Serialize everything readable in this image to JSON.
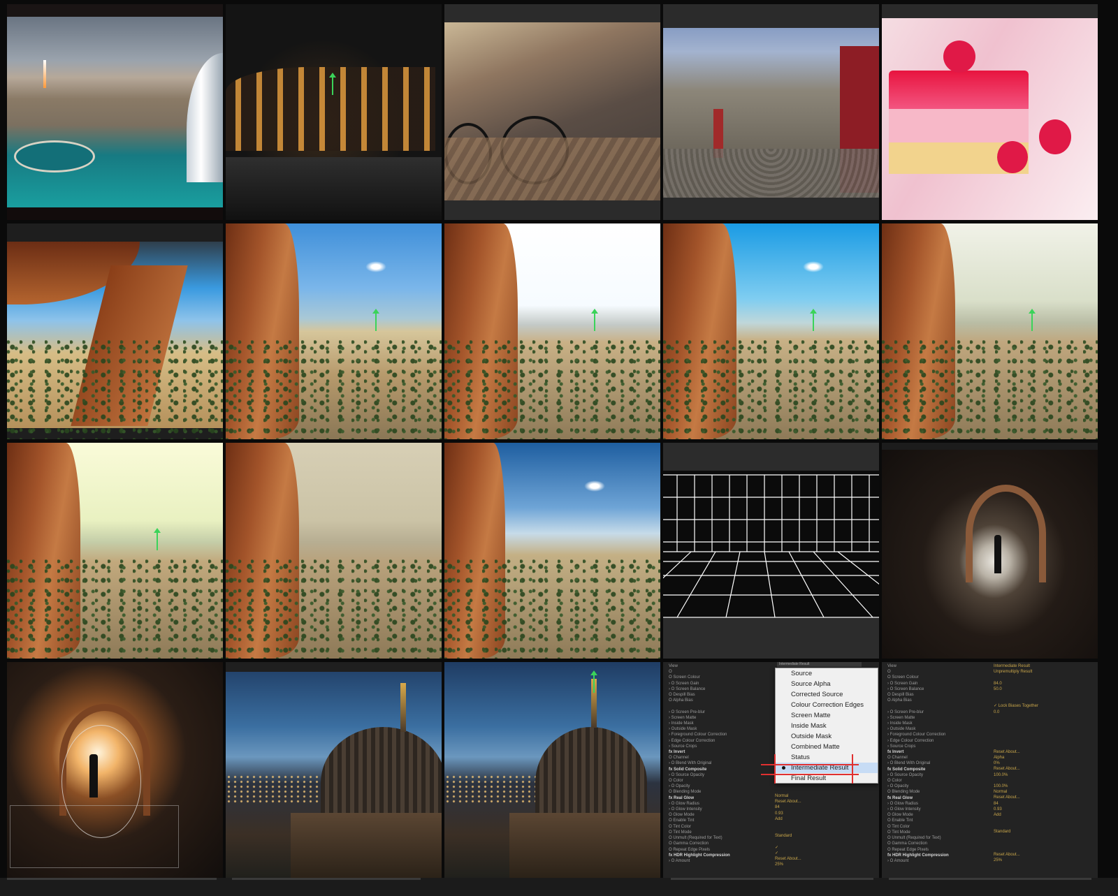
{
  "tiles": [
    {
      "id": "dubai-skyline-photo",
      "kind": "photo"
    },
    {
      "id": "colosseum-night-render",
      "kind": "photo"
    },
    {
      "id": "bicycle-street-photo",
      "kind": "photo"
    },
    {
      "id": "stone-alley-photo",
      "kind": "photo"
    },
    {
      "id": "raspberry-cake-photo",
      "kind": "photo"
    },
    {
      "id": "desert-arch-source",
      "kind": "photo"
    },
    {
      "id": "desert-sky-blue",
      "kind": "photo"
    },
    {
      "id": "desert-sky-white",
      "kind": "photo"
    },
    {
      "id": "desert-sky-cyan",
      "kind": "photo"
    },
    {
      "id": "desert-sky-sage",
      "kind": "photo"
    },
    {
      "id": "desert-sky-lime",
      "kind": "photo"
    },
    {
      "id": "desert-sky-tan",
      "kind": "photo"
    },
    {
      "id": "desert-sky-deep-blue",
      "kind": "photo"
    },
    {
      "id": "perspective-grid-plane",
      "kind": "render"
    },
    {
      "id": "tunnel-silhouette-photo",
      "kind": "photo"
    },
    {
      "id": "tunnel-warm-mask-photo",
      "kind": "photo"
    },
    {
      "id": "berlin-dome-dusk",
      "kind": "photo"
    },
    {
      "id": "berlin-dome-3d-axes",
      "kind": "photo"
    },
    {
      "id": "keylight-view-dropdown",
      "kind": "panel"
    },
    {
      "id": "keylight-effect-controls",
      "kind": "panel"
    }
  ],
  "panel_left": {
    "view_label": "View",
    "view_value": "Intermediate Result",
    "rows": [
      "View",
      "Ö",
      "Ö Screen Colour",
      "› Ö Screen Gain",
      "› Ö Screen Balance",
      "  Ö Despill Bias",
      "  Ö Alpha Bias",
      "",
      "› Ö Screen Pre-blur",
      "› Screen Matte",
      "› Inside Mask",
      "› Outside Mask",
      "› Foreground Colour Correction",
      "› Edge Colour Correction",
      "› Source Crops",
      "fx Invert",
      "  Ö Channel",
      "› Ö Blend With Original",
      "fx Solid Composite",
      "› Ö Source Opacity",
      "  Ö Color",
      "› Ö Opacity",
      "  Ö Blending Mode",
      "fx Real Glow",
      "› Ö Glow Radius",
      "› Ö Glow Intensity",
      "  Ö Glow Mode",
      "  Ö Enable Tint",
      "  Ö Tint Color",
      "  Ö Tint Mode",
      "  Ö Unmult (Required for Text)",
      "  Ö Gamma Correction",
      "  Ö Repeat Edge Pixels",
      "fx HDR Highlight Compression",
      "› Ö Amount"
    ],
    "dropdown_options": [
      "Source",
      "Source Alpha",
      "Corrected Source",
      "Colour Correction Edges",
      "Screen Matte",
      "Inside Mask",
      "Outside Mask",
      "Combined Matte",
      "Status",
      "Intermediate Result",
      "Final Result"
    ],
    "selected_option": "Intermediate Result",
    "values": [
      "Normal",
      "Reset      About...",
      "84",
      "0.93",
      "Add",
      "",
      "",
      "Standard",
      "",
      "✓",
      "✓",
      "Reset      About...",
      "25%"
    ]
  },
  "panel_right": {
    "rows": [
      "View",
      "Ö",
      "Ö Screen Colour",
      "› Ö Screen Gain",
      "› Ö Screen Balance",
      "  Ö Despill Bias",
      "  Ö Alpha Bias",
      "",
      "› Ö Screen Pre-blur",
      "› Screen Matte",
      "› Inside Mask",
      "› Outside Mask",
      "› Foreground Colour Correction",
      "› Edge Colour Correction",
      "› Source Crops",
      "fx Invert",
      "  Ö Channel",
      "› Ö Blend With Original",
      "fx Solid Composite",
      "› Ö Source Opacity",
      "  Ö Color",
      "› Ö Opacity",
      "  Ö Blending Mode",
      "fx Real Glow",
      "› Ö Glow Radius",
      "› Ö Glow Intensity",
      "  Ö Glow Mode",
      "  Ö Enable Tint",
      "  Ö Tint Color",
      "  Ö Tint Mode",
      "  Ö Unmult (Required for Text)",
      "  Ö Gamma Correction",
      "  Ö Repeat Edge Pixels",
      "fx HDR Highlight Compression",
      "› Ö Amount"
    ],
    "values": [
      "Intermediate Result",
      "Unpremultiply Result",
      "",
      "84.0",
      "50.0",
      "",
      "",
      "✓ Lock Biases Together",
      "0.0",
      "",
      "",
      "",
      "",
      "",
      "",
      "Reset      About...",
      "Alpha",
      "0%",
      "Reset      About...",
      "100.0%",
      "",
      "100.0%",
      "Normal",
      "Reset      About...",
      "84",
      "0.93",
      "Add",
      "",
      "",
      "Standard",
      "",
      "",
      "",
      "Reset      About...",
      "25%"
    ]
  },
  "colors": {
    "background": "#0a0a0a",
    "panel": "#232323",
    "accent_value": "#c9a64a",
    "highlight": "#1f4f8f",
    "annotation_red": "#e03030",
    "marker_green": "#3bd35a"
  }
}
